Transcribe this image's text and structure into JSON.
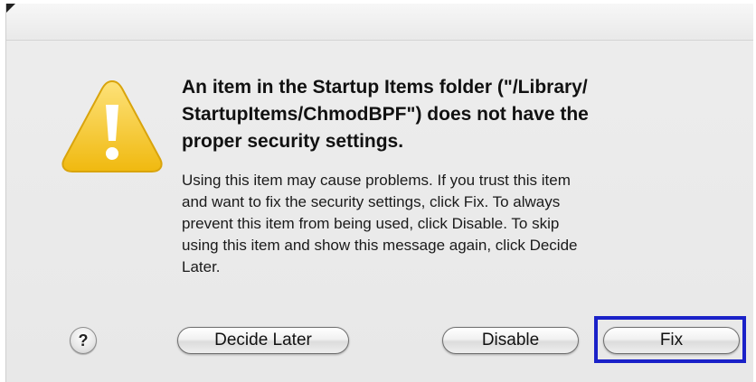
{
  "dialog": {
    "headline": "An item in the Startup Items folder (\"/Library/StartupItems/ChmodBPF\") does not have the proper security settings.",
    "headline_lines": [
      "An item in the Startup Items folder (\"/Library/",
      "StartupItems/ChmodBPF\") does not have the",
      "proper security settings."
    ],
    "message_lines": [
      "Using this item may cause problems.  If you trust this item",
      "and want to fix the security settings, click Fix.  To always",
      "prevent this item from being used, click Disable.  To skip",
      "using this item and show this message again, click Decide",
      "Later."
    ],
    "icon": "warning-triangle-icon"
  },
  "buttons": {
    "help_label": "?",
    "decide_later_label": "Decide Later",
    "disable_label": "Disable",
    "fix_label": "Fix"
  },
  "colors": {
    "focus_ring": "#1a21c8",
    "warning_yellow": "#f3c21a"
  }
}
